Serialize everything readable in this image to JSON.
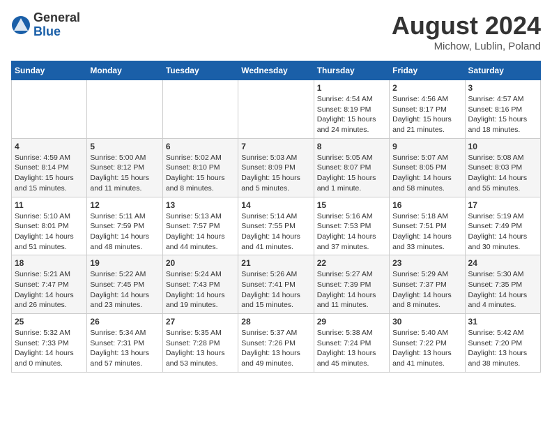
{
  "header": {
    "logo_general": "General",
    "logo_blue": "Blue",
    "month_title": "August 2024",
    "location": "Michow, Lublin, Poland"
  },
  "weekdays": [
    "Sunday",
    "Monday",
    "Tuesday",
    "Wednesday",
    "Thursday",
    "Friday",
    "Saturday"
  ],
  "weeks": [
    [
      {
        "day": "",
        "info": ""
      },
      {
        "day": "",
        "info": ""
      },
      {
        "day": "",
        "info": ""
      },
      {
        "day": "",
        "info": ""
      },
      {
        "day": "1",
        "info": "Sunrise: 4:54 AM\nSunset: 8:19 PM\nDaylight: 15 hours and 24 minutes."
      },
      {
        "day": "2",
        "info": "Sunrise: 4:56 AM\nSunset: 8:17 PM\nDaylight: 15 hours and 21 minutes."
      },
      {
        "day": "3",
        "info": "Sunrise: 4:57 AM\nSunset: 8:16 PM\nDaylight: 15 hours and 18 minutes."
      }
    ],
    [
      {
        "day": "4",
        "info": "Sunrise: 4:59 AM\nSunset: 8:14 PM\nDaylight: 15 hours and 15 minutes."
      },
      {
        "day": "5",
        "info": "Sunrise: 5:00 AM\nSunset: 8:12 PM\nDaylight: 15 hours and 11 minutes."
      },
      {
        "day": "6",
        "info": "Sunrise: 5:02 AM\nSunset: 8:10 PM\nDaylight: 15 hours and 8 minutes."
      },
      {
        "day": "7",
        "info": "Sunrise: 5:03 AM\nSunset: 8:09 PM\nDaylight: 15 hours and 5 minutes."
      },
      {
        "day": "8",
        "info": "Sunrise: 5:05 AM\nSunset: 8:07 PM\nDaylight: 15 hours and 1 minute."
      },
      {
        "day": "9",
        "info": "Sunrise: 5:07 AM\nSunset: 8:05 PM\nDaylight: 14 hours and 58 minutes."
      },
      {
        "day": "10",
        "info": "Sunrise: 5:08 AM\nSunset: 8:03 PM\nDaylight: 14 hours and 55 minutes."
      }
    ],
    [
      {
        "day": "11",
        "info": "Sunrise: 5:10 AM\nSunset: 8:01 PM\nDaylight: 14 hours and 51 minutes."
      },
      {
        "day": "12",
        "info": "Sunrise: 5:11 AM\nSunset: 7:59 PM\nDaylight: 14 hours and 48 minutes."
      },
      {
        "day": "13",
        "info": "Sunrise: 5:13 AM\nSunset: 7:57 PM\nDaylight: 14 hours and 44 minutes."
      },
      {
        "day": "14",
        "info": "Sunrise: 5:14 AM\nSunset: 7:55 PM\nDaylight: 14 hours and 41 minutes."
      },
      {
        "day": "15",
        "info": "Sunrise: 5:16 AM\nSunset: 7:53 PM\nDaylight: 14 hours and 37 minutes."
      },
      {
        "day": "16",
        "info": "Sunrise: 5:18 AM\nSunset: 7:51 PM\nDaylight: 14 hours and 33 minutes."
      },
      {
        "day": "17",
        "info": "Sunrise: 5:19 AM\nSunset: 7:49 PM\nDaylight: 14 hours and 30 minutes."
      }
    ],
    [
      {
        "day": "18",
        "info": "Sunrise: 5:21 AM\nSunset: 7:47 PM\nDaylight: 14 hours and 26 minutes."
      },
      {
        "day": "19",
        "info": "Sunrise: 5:22 AM\nSunset: 7:45 PM\nDaylight: 14 hours and 23 minutes."
      },
      {
        "day": "20",
        "info": "Sunrise: 5:24 AM\nSunset: 7:43 PM\nDaylight: 14 hours and 19 minutes."
      },
      {
        "day": "21",
        "info": "Sunrise: 5:26 AM\nSunset: 7:41 PM\nDaylight: 14 hours and 15 minutes."
      },
      {
        "day": "22",
        "info": "Sunrise: 5:27 AM\nSunset: 7:39 PM\nDaylight: 14 hours and 11 minutes."
      },
      {
        "day": "23",
        "info": "Sunrise: 5:29 AM\nSunset: 7:37 PM\nDaylight: 14 hours and 8 minutes."
      },
      {
        "day": "24",
        "info": "Sunrise: 5:30 AM\nSunset: 7:35 PM\nDaylight: 14 hours and 4 minutes."
      }
    ],
    [
      {
        "day": "25",
        "info": "Sunrise: 5:32 AM\nSunset: 7:33 PM\nDaylight: 14 hours and 0 minutes."
      },
      {
        "day": "26",
        "info": "Sunrise: 5:34 AM\nSunset: 7:31 PM\nDaylight: 13 hours and 57 minutes."
      },
      {
        "day": "27",
        "info": "Sunrise: 5:35 AM\nSunset: 7:28 PM\nDaylight: 13 hours and 53 minutes."
      },
      {
        "day": "28",
        "info": "Sunrise: 5:37 AM\nSunset: 7:26 PM\nDaylight: 13 hours and 49 minutes."
      },
      {
        "day": "29",
        "info": "Sunrise: 5:38 AM\nSunset: 7:24 PM\nDaylight: 13 hours and 45 minutes."
      },
      {
        "day": "30",
        "info": "Sunrise: 5:40 AM\nSunset: 7:22 PM\nDaylight: 13 hours and 41 minutes."
      },
      {
        "day": "31",
        "info": "Sunrise: 5:42 AM\nSunset: 7:20 PM\nDaylight: 13 hours and 38 minutes."
      }
    ]
  ]
}
